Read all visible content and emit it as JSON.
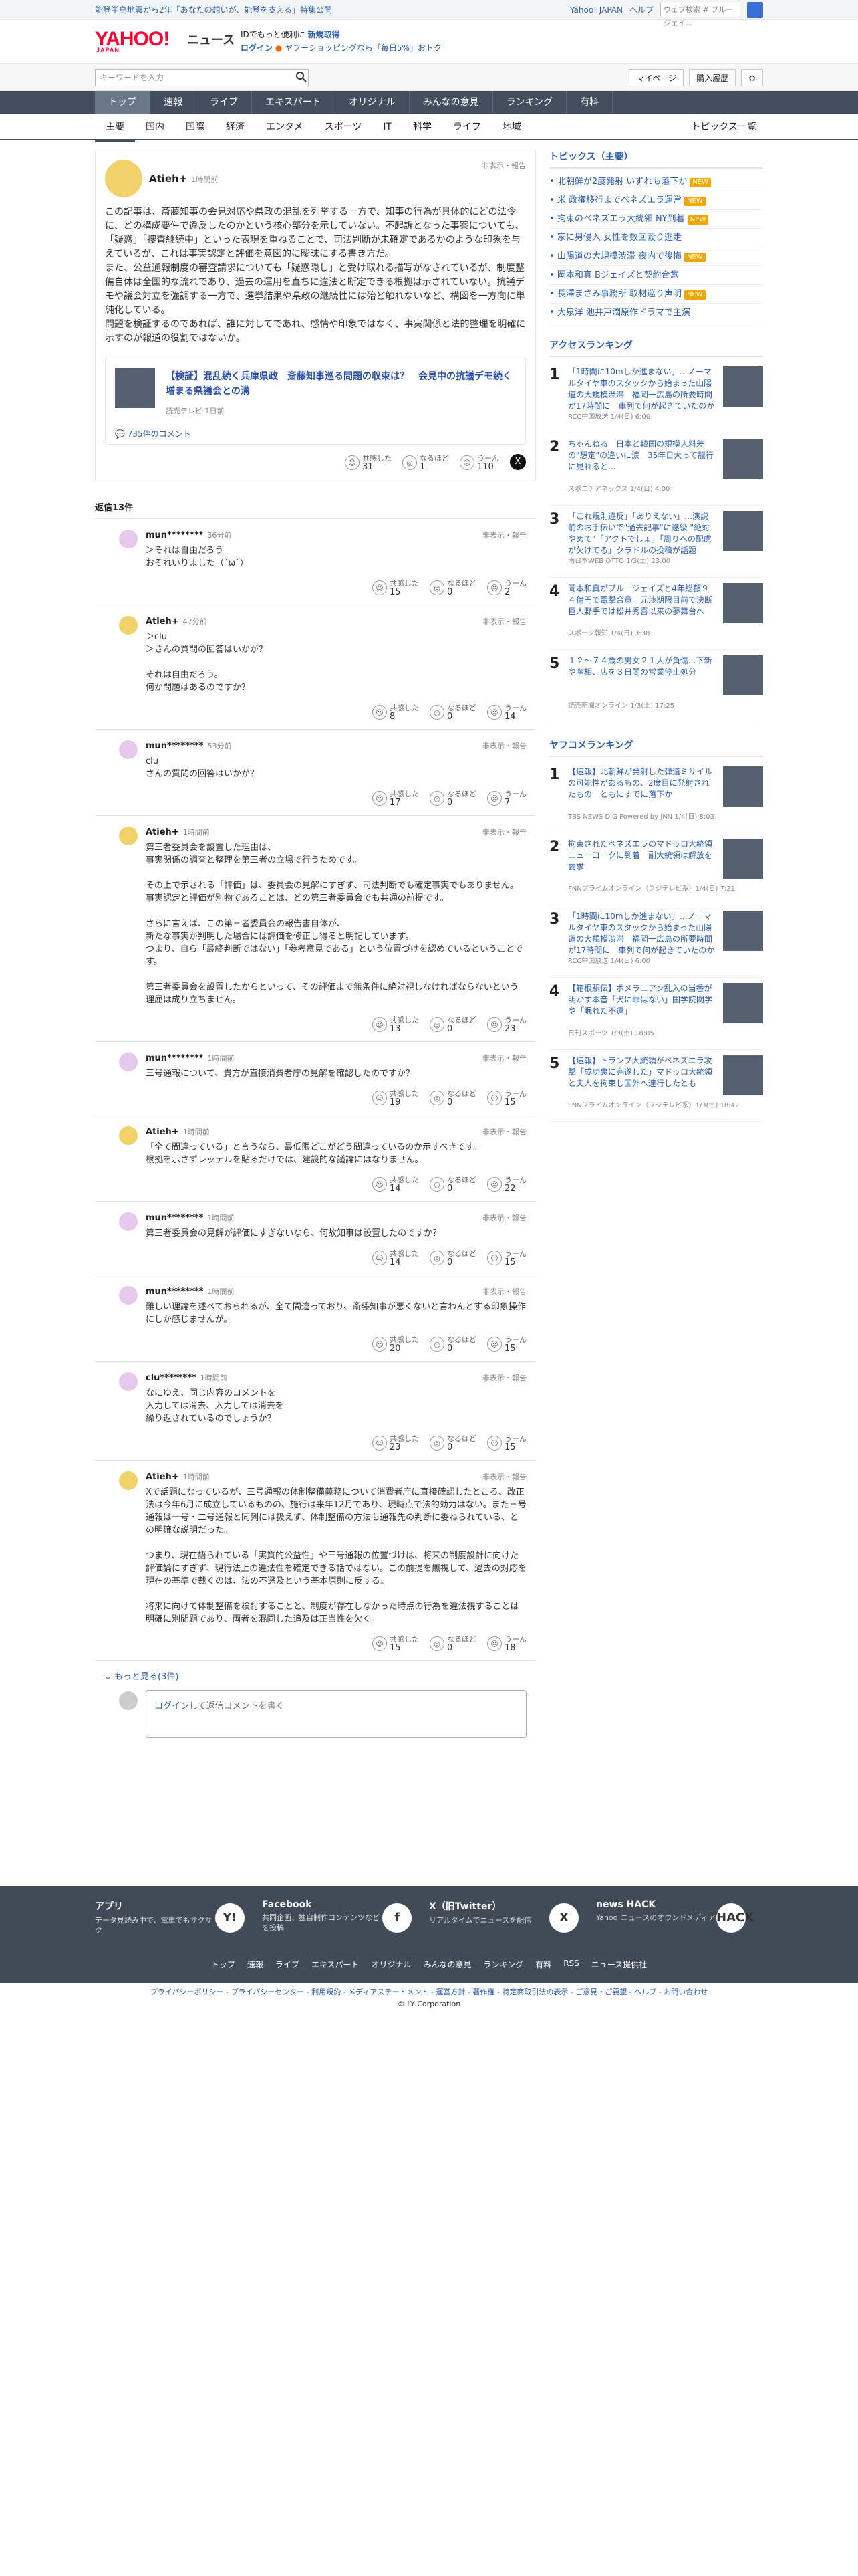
{
  "promo": {
    "left": "能登半島地震から2年「あなたの想いが、能登を支える」特集公開",
    "links": [
      "Yahoo! JAPAN",
      "ヘルプ"
    ],
    "search_placeholder": "ウェブ検索",
    "search_tag": "# プルージェイ..."
  },
  "header": {
    "logo": "YAHOO!",
    "logo_sub": "JAPAN",
    "service": "ニュース",
    "msg1": "IDでもっと便利に",
    "msg1_link": "新規取得",
    "msg2_link": "ログイン",
    "msg2": "ヤフーショッピングなら「毎日5%」おトク"
  },
  "search": {
    "placeholder": "キーワードを入力",
    "mypage": "マイページ",
    "history": "購入履歴"
  },
  "nav": [
    "トップ",
    "速報",
    "ライブ",
    "エキスパート",
    "オリジナル",
    "みんなの意見",
    "ランキング",
    "有料"
  ],
  "subnav": [
    "主要",
    "国内",
    "国際",
    "経済",
    "エンタメ",
    "スポーツ",
    "IT",
    "科学",
    "ライフ",
    "地域"
  ],
  "subnav_right": "トピックス一覧",
  "main_comment": {
    "name": "Atieh+",
    "time": "1時間前",
    "report": "非表示・報告",
    "text": "この記事は、斎藤知事の会見対応や県政の混乱を列挙する一方で、知事の行為が具体的にどの法令に、どの構成要件で違反したのかという核心部分を示していない。不起訴となった事案についても、「疑惑」「捜査継続中」といった表現を重ねることで、司法判断が未確定であるかのような印象を与えているが、これは事実認定と評価を意図的に曖昧にする書き方だ。\nまた、公益通報制度の審査請求についても「疑惑隠し」と受け取れる描写がなされているが、制度整備自体は全国的な流れであり、過去の運用を直ちに違法と断定できる根拠は示されていない。抗議デモや議会対立を強調する一方で、選挙結果や県政の継続性には殆ど触れないなど、構図を一方向に単純化している。\n問題を検証するのであれば、誰に対してであれ、感情や印象ではなく、事実関係と法的整理を明確に示すのが報道の役割ではないか。",
    "article_title": "【検証】混乱続く兵庫県政　斎藤知事巡る問題の収束は？　会見中の抗議デモ続く　増まる県議会との溝",
    "article_source": "読売テレビ 1日前",
    "article_comments": "735件のコメント",
    "reactions": [
      {
        "label": "共感した",
        "count": "31"
      },
      {
        "label": "なるほど",
        "count": "1"
      },
      {
        "label": "うーん",
        "count": "110"
      }
    ]
  },
  "reply_header": "返信13件",
  "replies": [
    {
      "name": "mun********",
      "time": "36分前",
      "text": "＞それは自由だろう\nおそれいりました（´ω`）",
      "reactions": [
        "15",
        "0",
        "2"
      ]
    },
    {
      "name": "Atieh+",
      "time": "47分前",
      "text": "＞clu\n＞さんの質問の回答はいかが？\n\nそれは自由だろう。\n何か問題はあるのですか？",
      "reactions": [
        "8",
        "0",
        "14"
      ]
    },
    {
      "name": "mun********",
      "time": "53分前",
      "text": "clu\nさんの質問の回答はいかが？",
      "reactions": [
        "17",
        "0",
        "7"
      ]
    },
    {
      "name": "Atieh+",
      "time": "1時間前",
      "text": "第三者委員会を設置した理由は、\n事実関係の調査と整理を第三者の立場で行うためです。\n\nその上で示される「評価」は、委員会の見解にすぎず、司法判断でも確定事実でもありません。\n事実認定と評価が別物であることは、どの第三者委員会でも共通の前提です。\n\nさらに言えば、この第三者委員会の報告書自体が、\n新たな事実が判明した場合には評価を修正し得ると明記しています。\nつまり、自ら「最終判断ではない」「参考意見である」という位置づけを認めているということです。\n\n第三者委員会を設置したからといって、その評価まで無条件に絶対視しなければならないという理屈は成り立ちません。",
      "reactions": [
        "13",
        "0",
        "23"
      ]
    },
    {
      "name": "mun********",
      "time": "1時間前",
      "text": "三号通報について、貴方が直接消費者庁の見解を確認したのですか？",
      "reactions": [
        "19",
        "0",
        "15"
      ]
    },
    {
      "name": "Atieh+",
      "time": "1時間前",
      "text": "「全て間違っている」と言うなら、最低限どこがどう間違っているのか示すべきです。\n根拠を示さずレッテルを貼るだけでは、建設的な議論にはなりません。",
      "reactions": [
        "14",
        "0",
        "22"
      ]
    },
    {
      "name": "mun********",
      "time": "1時間前",
      "text": "第三者委員会の見解が評価にすぎないなら、何故知事は設置したのですか？",
      "reactions": [
        "14",
        "0",
        "15"
      ]
    },
    {
      "name": "mun********",
      "time": "1時間前",
      "text": "難しい理論を述べておられるが、全て間違っており、斎藤知事が悪くないと言わんとする印象操作にしか感じませんが。",
      "reactions": [
        "20",
        "0",
        "15"
      ]
    },
    {
      "name": "clu********",
      "time": "1時間前",
      "text": "なにゆえ、同じ内容のコメントを\n入力しては消去、入力しては消去を\n繰り返されているのでしょうか？",
      "reactions": [
        "23",
        "0",
        "15"
      ]
    },
    {
      "name": "Atieh+",
      "time": "1時間前",
      "text": "Xで話題になっているが、三号通報の体制整備義務について消費者庁に直接確認したところ、改正法は今年6月に成立しているものの、施行は来年12月であり、現時点で法的効力はない。また三号通報は一号・二号通報と同列には扱えず、体制整備の方法も通報先の判断に委ねられている、との明確な説明だった。\n\nつまり、現在語られている「実質的公益性」や三号通報の位置づけは、将来の制度設計に向けた評価論にすぎず、現行法上の違法性を確定できる話ではない。この前提を無視して、過去の対応を現在の基準で裁くのは、法の不遡及という基本原則に反する。\n\n将来に向けて体制整備を検討することと、制度が存在しなかった時点の行為を違法視することは明確に別問題であり、両者を混同した追及は正当性を欠く。",
      "reactions": [
        "15",
        "0",
        "18"
      ]
    }
  ],
  "reaction_labels": [
    "共感した",
    "なるほど",
    "うーん"
  ],
  "more": "もっと見る(3件)",
  "comment_box": {
    "login": "ログイン",
    "rest": "して返信コメントを書く"
  },
  "topics": {
    "title": "トピックス（主要）",
    "items": [
      {
        "t": "北朝鮮が2度発射 いずれも落下か",
        "n": "NEW"
      },
      {
        "t": "米 政権移行までベネズエラ運営",
        "n": "NEW"
      },
      {
        "t": "拘束のベネズエラ大統領 NY到着",
        "n": "NEW"
      },
      {
        "t": "家に男侵入 女性を数回殴り逃走",
        "n": ""
      },
      {
        "t": "山陽道の大規模渋滞 夜内で後悔",
        "n": "NEW"
      },
      {
        "t": "岡本和真 Bジェイズと契約合意",
        "n": ""
      },
      {
        "t": "長澤まさみ事務所 取材巡り声明",
        "n": "NEW"
      },
      {
        "t": "大泉洋 池井戸潤原作ドラマで主演",
        "n": ""
      }
    ]
  },
  "access_ranking": {
    "title": "アクセスランキング",
    "items": [
      {
        "no": "1",
        "t": "「1時間に10mしか進まない」…ノーマルタイヤ車のスタックから始まった山陽道の大規模渋滞　福岡一広島の所要時間が17時間に　車列で何が起きていたのか",
        "s": "RCC中国放送 1/4(日) 6:00"
      },
      {
        "no": "2",
        "t": "ちゃんねる　日本と韓国の規模人料差の\"想定\"の違いに涙　35年日大って龍行に見れると...",
        "s": "スポニチアネックス 1/4(日) 4:00"
      },
      {
        "no": "3",
        "t": "「これ規則違反」「ありえない」…演説前のお手伝いで\"過去記事\"に遂級 \"絶対やめて\"「アクトでしょ」「周りへの配慮が欠けてる」クラドルの投稿が話題",
        "s": "南日本WEB OTTO 1/3(土) 23:00"
      },
      {
        "no": "4",
        "t": "岡本和真がブルージェイズと4年総額９４億円で電撃合意　元渉期限目前で決断　巨人野手では松井秀喜以来の夢舞台へ",
        "s": "スポーツ報知 1/4(日) 3:38"
      },
      {
        "no": "5",
        "t": "１２～７４歳の男女２１人が負傷...下新や噛相、店を３日間の営業停止処分",
        "s": "読売新聞オンライン 1/3(土) 17:25"
      }
    ]
  },
  "yafoo_ranking": {
    "title": "ヤフコメランキング",
    "items": [
      {
        "no": "1",
        "t": "【速報】北朝鮮が発射した弾道ミサイルの可能性があるもの、2度目に発射されたもの　ともにすでに落下か",
        "s": "TBS NEWS DIG Powered by JNN 1/4(日) 8:03"
      },
      {
        "no": "2",
        "t": "拘束されたベネズエラのマドゥロ大統領ニューヨークに到着　副大統領は解放を要求",
        "s": "FNNプライムオンライン（フジテレビ系）1/4(日) 7:21"
      },
      {
        "no": "3",
        "t": "「1時間に10mしか進まない」…ノーマルタイヤ車のスタックから始まった山陽道の大規模渋滞　福岡一広島の所要時間が17時間に　車列で何が起きていたのか",
        "s": "RCC中国放送 1/4(日) 6:00"
      },
      {
        "no": "4",
        "t": "【箱根駅伝】ポメラニアン乱入の当番が明かす本音「犬に罪はない」国学院関学や「眠れた不運」",
        "s": "日刊スポーツ 1/3(土) 18:05"
      },
      {
        "no": "5",
        "t": "【速報】トランプ大統領がベネズエラ攻撃「成功裏に完遂した」マドゥロ大統領と夫人を拘束し国外へ連行したとも",
        "s": "FNNプライムオンライン（フジテレビ系）1/3(土) 18:42"
      }
    ]
  },
  "footer": {
    "apps": [
      {
        "t": "アプリ",
        "d": "データ見読み中で、電車でもサクサク",
        "i": "Y!"
      },
      {
        "t": "Facebook",
        "d": "共同企画、独自制作コンテンツなどを投稿",
        "i": "f"
      },
      {
        "t": "X（旧Twitter）",
        "d": "リアルタイムでニュースを配信",
        "i": "X"
      },
      {
        "t": "news HACK",
        "d": "Yahoo!ニュースのオウンドメディア",
        "i": "HACK"
      }
    ],
    "links": [
      "トップ",
      "速報",
      "ライブ",
      "エキスパート",
      "オリジナル",
      "みんなの意見",
      "ランキング",
      "有料",
      "RSS",
      "ニュース提供社"
    ],
    "bottom": "プライバシーポリシー - プライバシーセンター - 利用規約 - メディアステートメント - 運営方針 - 著作権 - 特定商取引法の表示 - ご意見・ご要望 - ヘルプ - お問い合わせ",
    "copyright": "© LY Corporation"
  }
}
